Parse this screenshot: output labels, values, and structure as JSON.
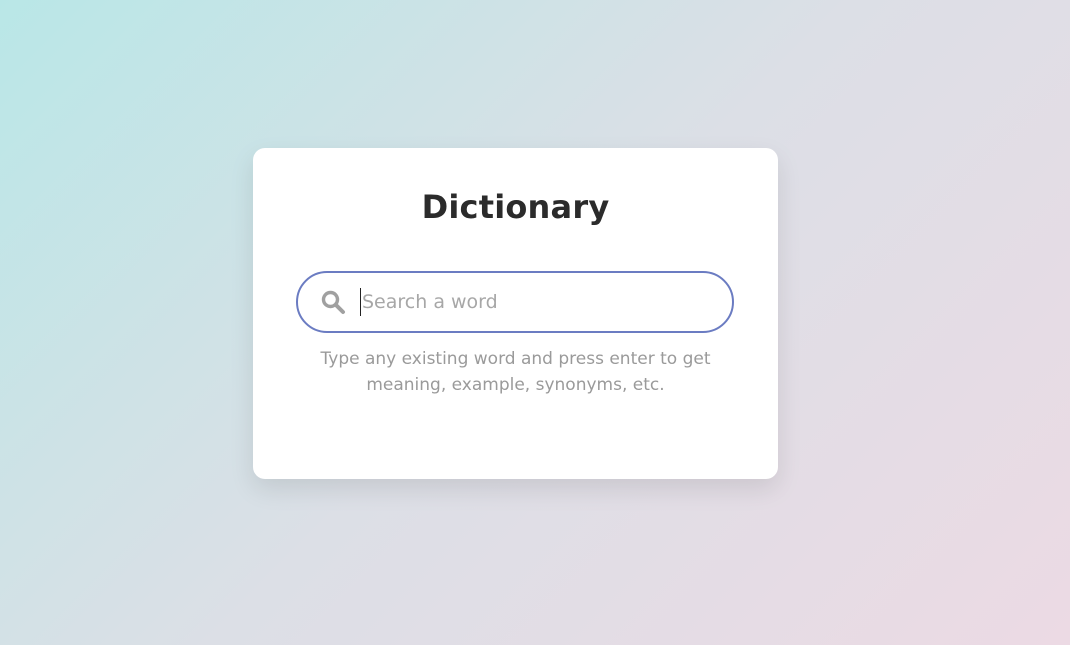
{
  "app": {
    "title": "Dictionary"
  },
  "search": {
    "placeholder": "Search a word",
    "value": "",
    "icon": "search-icon"
  },
  "hint": {
    "text": "Type any existing word and press enter to get meaning, example, synonyms, etc."
  },
  "colors": {
    "accent": "#6b7cc2",
    "title": "#2b2b2b",
    "hint": "#9a9a9a",
    "icon": "#a0a0a0",
    "background_start": "#b9e7e7",
    "background_end": "#ecdae4"
  }
}
